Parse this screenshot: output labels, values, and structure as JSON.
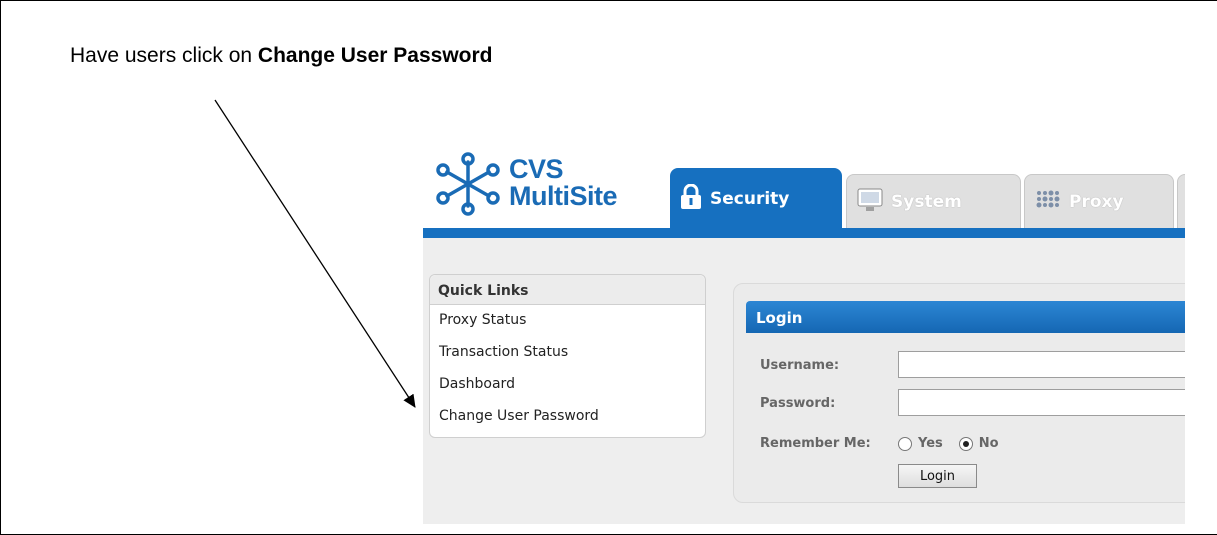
{
  "instruction": {
    "prefix": "Have users click on ",
    "emphasis": "Change User Password"
  },
  "app": {
    "logo": {
      "line1": "CVS",
      "line2": "MultiSite",
      "icon": "network-node-icon"
    },
    "tabs": [
      {
        "label": "Security",
        "icon": "lock-icon",
        "active": true
      },
      {
        "label": "System",
        "icon": "monitor-icon",
        "active": false
      },
      {
        "label": "Proxy",
        "icon": "proxy-grid-icon",
        "active": false
      }
    ],
    "quick_links": {
      "title": "Quick Links",
      "items": [
        "Proxy Status",
        "Transaction Status",
        "Dashboard",
        "Change User Password"
      ]
    },
    "login": {
      "title": "Login",
      "username_label": "Username:",
      "username_value": "",
      "password_label": "Password:",
      "password_value": "",
      "remember_label": "Remember Me:",
      "remember_options": [
        "Yes",
        "No"
      ],
      "remember_selected": "No",
      "button": "Login"
    },
    "colors": {
      "brand_blue": "#1670c0",
      "logo_blue": "#1a6bb5"
    }
  }
}
